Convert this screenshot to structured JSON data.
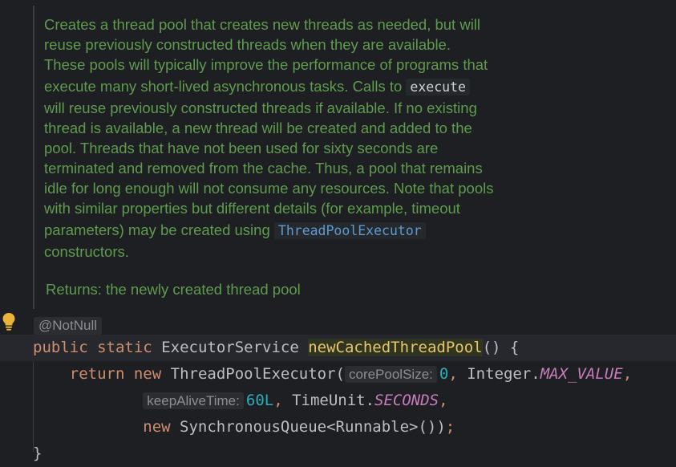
{
  "doc": {
    "lines": [
      "Creates a thread pool that creates new threads as needed, but will",
      "reuse previously constructed threads when they are available.",
      "These pools will typically improve the performance of programs that"
    ],
    "line4_prefix": "execute many short-lived asynchronous tasks. Calls to",
    "line4_code": "execute",
    "lines_mid": [
      "will reuse previously constructed threads if available. If no existing",
      "thread is available, a new thread will be created and added to the",
      "pool. Threads that have not been used for sixty seconds are",
      "terminated and removed from the cache. Thus, a pool that remains",
      "idle for long enough will not consume any resources. Note that pools",
      "with similar properties but different details (for example, timeout"
    ],
    "line11_prefix": "parameters) may be created using",
    "line11_link": "ThreadPoolExecutor",
    "line12": "constructors.",
    "returns": "Returns: the newly created thread pool"
  },
  "annotation_hint": "@NotNull",
  "code": {
    "line1": {
      "kw1": "public",
      "kw2": "static",
      "type": "ExecutorService",
      "method": "newCachedThreadPool",
      "tail": "() {"
    },
    "line2": {
      "indent": "    ",
      "kw1": "return",
      "kw2": "new",
      "cls": "ThreadPoolExecutor(",
      "hint1": "corePoolSize:",
      "num1": "0",
      "sep": ", ",
      "cls2": "Integer.",
      "const1": "MAX_VALUE",
      "comma": ","
    },
    "line3": {
      "indent": "            ",
      "hint2": "keepAliveTime:",
      "num2": "60L",
      "sep": ", ",
      "cls": "TimeUnit.",
      "const2": "SECONDS",
      "comma": ","
    },
    "line4": {
      "indent": "            ",
      "kw": "new",
      "rest": " SynchronousQueue<Runnable>())",
      "semi": ";"
    },
    "line5": {
      "text": "}"
    }
  },
  "colors": {
    "doc_text": "#5f9b4f",
    "keyword": "#cf8e6d",
    "constant": "#c77dbb",
    "number": "#2aacb8",
    "link": "#5e99d5",
    "bulb": "#e8b43a"
  },
  "icons": {
    "bulb": "lightbulb-icon"
  }
}
